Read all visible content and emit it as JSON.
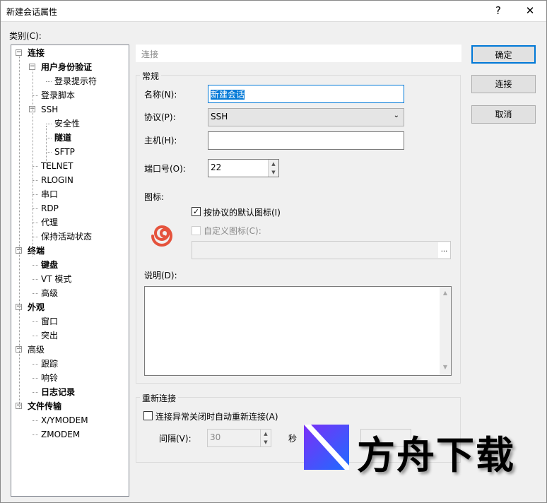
{
  "window": {
    "title": "新建会话属性",
    "help": "?",
    "close": "✕"
  },
  "category_label": "类别(C):",
  "tree": [
    {
      "label": "连接",
      "level": 0,
      "bold": true,
      "expander": "⊟"
    },
    {
      "label": "用户身份验证",
      "level": 1,
      "bold": true,
      "expander": "⊟"
    },
    {
      "label": "登录提示符",
      "level": 2,
      "bold": false
    },
    {
      "label": "登录脚本",
      "level": 1,
      "bold": false
    },
    {
      "label": "SSH",
      "level": 1,
      "bold": false,
      "expander": "⊟"
    },
    {
      "label": "安全性",
      "level": 2,
      "bold": false
    },
    {
      "label": "隧道",
      "level": 2,
      "bold": true
    },
    {
      "label": "SFTP",
      "level": 2,
      "bold": false
    },
    {
      "label": "TELNET",
      "level": 1,
      "bold": false
    },
    {
      "label": "RLOGIN",
      "level": 1,
      "bold": false
    },
    {
      "label": "串口",
      "level": 1,
      "bold": false
    },
    {
      "label": "RDP",
      "level": 1,
      "bold": false
    },
    {
      "label": "代理",
      "level": 1,
      "bold": false
    },
    {
      "label": "保持活动状态",
      "level": 1,
      "bold": false
    },
    {
      "label": "终端",
      "level": 0,
      "bold": true,
      "expander": "⊟"
    },
    {
      "label": "键盘",
      "level": 1,
      "bold": true
    },
    {
      "label": "VT 模式",
      "level": 1,
      "bold": false
    },
    {
      "label": "高级",
      "level": 1,
      "bold": false
    },
    {
      "label": "外观",
      "level": 0,
      "bold": true,
      "expander": "⊟"
    },
    {
      "label": "窗口",
      "level": 1,
      "bold": false
    },
    {
      "label": "突出",
      "level": 1,
      "bold": false
    },
    {
      "label": "高级",
      "level": 0,
      "bold": false,
      "expander": "⊟"
    },
    {
      "label": "跟踪",
      "level": 1,
      "bold": false
    },
    {
      "label": "响铃",
      "level": 1,
      "bold": false
    },
    {
      "label": "日志记录",
      "level": 1,
      "bold": true
    },
    {
      "label": "文件传输",
      "level": 0,
      "bold": true,
      "expander": "⊟"
    },
    {
      "label": "X/YMODEM",
      "level": 1,
      "bold": false
    },
    {
      "label": "ZMODEM",
      "level": 1,
      "bold": false
    }
  ],
  "section_heading": "连接",
  "general": {
    "title": "常规",
    "name_label": "名称(N):",
    "name_value": "新建会话",
    "protocol_label": "协议(P):",
    "protocol_value": "SSH",
    "host_label": "主机(H):",
    "host_value": "",
    "port_label": "端口号(O):",
    "port_value": "22",
    "icon_label": "图标:",
    "default_icon_label": "按协议的默认图标(I)",
    "default_icon_checked": true,
    "custom_icon_label": "自定义图标(C):",
    "custom_icon_checked": false,
    "browse": "...",
    "desc_label": "说明(D):",
    "desc_value": ""
  },
  "reconnect": {
    "title": "重新连接",
    "auto_label": "连接异常关闭时自动重新连接(A)",
    "auto_checked": false,
    "interval_label": "间隔(V):",
    "interval_value": "30",
    "seconds": "秒"
  },
  "buttons": {
    "ok": "确定",
    "connect": "连接",
    "cancel": "取消"
  },
  "watermark": {
    "text": "方舟下载"
  }
}
